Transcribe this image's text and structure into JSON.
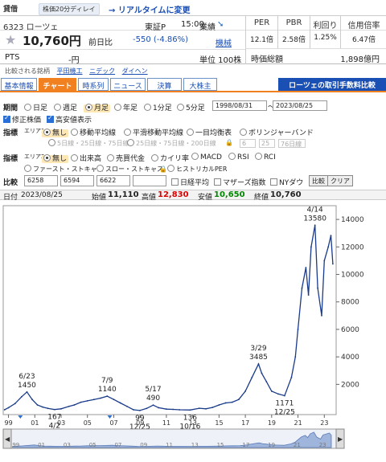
{
  "header": {
    "credit_tag": "貸借",
    "delay_badge": "株価20分ディレイ",
    "realtime_link": "→ リアルタイムに変更"
  },
  "stock": {
    "code_name": "6323 ローツェ",
    "market": "東証P",
    "time": "15:00",
    "price": "10,760円",
    "prev_label": "前日比",
    "change": "-550 (-4.86%)",
    "pts_label": "PTS",
    "pts_value": "-円",
    "gyoseki_label": "業績",
    "kenshu_label": "機械",
    "lot": "単位 100株",
    "star_icon": "star-icon"
  },
  "metrics": [
    {
      "label": "PER",
      "value": "12.1倍"
    },
    {
      "label": "PBR",
      "value": "2.58倍"
    },
    {
      "label": "利回り",
      "value": "1.25%"
    },
    {
      "label": "信用倍率",
      "value": "6.47倍"
    }
  ],
  "market_cap": {
    "label": "時価総額",
    "value": "1,898億円"
  },
  "listed": {
    "label": "比較される銘柄",
    "items": [
      "平田機工",
      "ニデック",
      "ダイヘン"
    ]
  },
  "tabs": [
    "基本情報",
    "チャート",
    "時系列",
    "ニュース",
    "決算",
    "大株主"
  ],
  "active_tab": "チャート",
  "fee_link": "ローツェの取引手数料比較",
  "controls": {
    "period_label": "期間",
    "period_options": [
      "日足",
      "週足",
      "月足",
      "年足",
      "1分足",
      "5分足"
    ],
    "period_selected": "月足",
    "date_from": "1998/08/31",
    "date_to": "2023/08/25",
    "date_sep": "〜",
    "adjusted": "修正株価",
    "high_low": "高安値表示",
    "indicator_label": "指標",
    "area1": "エリア1",
    "area1_options": [
      "無し",
      "移動平均線",
      "平滑移動平均線",
      "一目均衡表",
      "ボリンジャーバンド"
    ],
    "area1_sub": [
      "5日線・25日線・75日線",
      "25日線・75日線・200日線",
      "6",
      "25",
      "76日線"
    ],
    "area2": "エリア2",
    "area2_options": [
      "無し",
      "出来高",
      "売買代金",
      "カイリ率",
      "MACD",
      "RSI",
      "RCI"
    ],
    "area2_options_2": [
      "ファースト・ストキャス",
      "スロー・ストキャス",
      "ヒストリカルPER"
    ],
    "compare_label": "比較",
    "compare_inputs": [
      "6258",
      "6594",
      "6622",
      ""
    ],
    "compare_checks": [
      "日経平均",
      "マザーズ指数",
      "NYダウ"
    ],
    "compare_button": "比較",
    "clear_button": "クリア"
  },
  "chart_head": {
    "date_label": "日付",
    "date": "2023/08/25",
    "open_label": "始値",
    "open": "11,110",
    "high_label": "高値",
    "high": "12,830",
    "low_label": "安値",
    "low": "10,650",
    "close_label": "終値",
    "close": "10,760"
  },
  "chart_data": {
    "type": "line",
    "x": [
      1998.7,
      1999.0,
      1999.5,
      2000.0,
      2000.4,
      2000.8,
      2001.2,
      2001.6,
      2002.0,
      2002.5,
      2003.0,
      2003.6,
      2004.0,
      2004.5,
      2005.0,
      2005.5,
      2006.0,
      2006.5,
      2007.0,
      2007.5,
      2008.0,
      2008.5,
      2008.98,
      2009.5,
      2010.0,
      2010.4,
      2011.0,
      2011.5,
      2012.0,
      2012.8,
      2013.5,
      2014.0,
      2014.5,
      2015.0,
      2015.5,
      2016.0,
      2016.5,
      2017.0,
      2017.5,
      2018.0,
      2018.25,
      2018.6,
      2019.0,
      2019.5,
      2019.98,
      2020.5,
      2020.8,
      2021.0,
      2021.3,
      2021.6,
      2021.8,
      2022.0,
      2022.29,
      2022.5,
      2022.8,
      2023.0,
      2023.3,
      2023.5,
      2023.65
    ],
    "y": [
      150,
      300,
      600,
      1100,
      1450,
      900,
      500,
      350,
      250,
      167,
      220,
      400,
      500,
      700,
      800,
      900,
      1000,
      1140,
      900,
      650,
      400,
      150,
      99,
      250,
      490,
      300,
      200,
      180,
      150,
      136,
      260,
      220,
      320,
      500,
      650,
      700,
      900,
      1500,
      2500,
      3485,
      2800,
      2200,
      1500,
      1300,
      1171,
      2500,
      4000,
      6000,
      9000,
      10500,
      8500,
      12000,
      13580,
      9000,
      7000,
      11000,
      12000,
      12830,
      10760
    ],
    "xlabel": "",
    "ylabel": "",
    "ylim": [
      -200,
      15000
    ],
    "y_ticks": [
      2000,
      4000,
      6000,
      8000,
      10000,
      12000,
      14000
    ],
    "x_ticks": [
      "99",
      "01",
      "03",
      "05",
      "07",
      "09",
      "11",
      "13",
      "15",
      "17",
      "19",
      "21",
      "23"
    ],
    "annotations": [
      {
        "text": "6/23",
        "value": "1450",
        "x": 2000.4,
        "y": 1450,
        "pos": "above"
      },
      {
        "text": "167",
        "value": "4/2",
        "x": 2002.5,
        "y": 167,
        "pos": "below"
      },
      {
        "text": "7/9",
        "value": "1140",
        "x": 2006.5,
        "y": 1140,
        "pos": "above"
      },
      {
        "text": "99",
        "value": "12/25",
        "x": 2008.98,
        "y": 99,
        "pos": "below"
      },
      {
        "text": "5/17",
        "value": "490",
        "x": 2010.0,
        "y": 490,
        "pos": "above"
      },
      {
        "text": "136",
        "value": "10/16",
        "x": 2012.8,
        "y": 136,
        "pos": "below"
      },
      {
        "text": "3/29",
        "value": "3485",
        "x": 2018.0,
        "y": 3485,
        "pos": "above"
      },
      {
        "text": "1171",
        "value": "12/25",
        "x": 2019.98,
        "y": 1171,
        "pos": "below"
      },
      {
        "text": "4/14",
        "value": "13580",
        "x": 2022.29,
        "y": 13580,
        "pos": "above"
      }
    ],
    "grid": false,
    "line_color": "#1a3a8a"
  }
}
